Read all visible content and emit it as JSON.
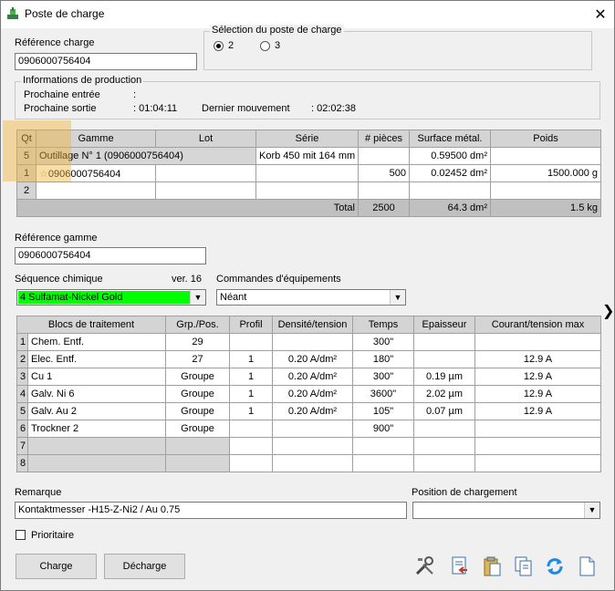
{
  "window": {
    "title": "Poste de charge"
  },
  "ref_charge": {
    "label": "Référence charge",
    "value": "0906000756404"
  },
  "selection": {
    "label": "Sélection du poste de charge",
    "opt1": "2",
    "opt2": "3"
  },
  "production": {
    "label": "Informations de production",
    "next_entry_label": "Prochaine entrée",
    "next_entry_value": ":",
    "next_exit_label": "Prochaine sortie",
    "next_exit_value": ": 01:04:11",
    "last_move_label": "Dernier mouvement",
    "last_move_value": ": 02:02:38"
  },
  "charge_table": {
    "headers": [
      "Qt",
      "Gamme",
      "Lot",
      "Série",
      "# pièces",
      "Surface métal.",
      "Poids"
    ],
    "rows": [
      [
        "5",
        "Outillage N° 1  (0906000756404)",
        "",
        "Korb 450 mit 164 mm",
        "",
        "0.59500 dm²",
        ""
      ],
      [
        "1",
        "0906000756404",
        "",
        "",
        "500",
        "0.02452 dm²",
        "1500.000 g"
      ],
      [
        "2",
        "",
        "",
        "",
        "",
        "",
        ""
      ]
    ],
    "total_label": "Total",
    "total_pieces": "2500",
    "total_surface": "64.3 dm²",
    "total_weight": "1.5 kg"
  },
  "ref_gamme": {
    "label": "Référence gamme",
    "value": "0906000756404"
  },
  "sequence": {
    "label": "Séquence chimique",
    "version": "ver. 16",
    "value": "4 Sulfamat-Nickel Gold",
    "color": "#00ff00"
  },
  "commands": {
    "label": "Commandes d'équipements",
    "value": "Néant"
  },
  "blocs_table": {
    "headers": [
      "Blocs de traitement",
      "Grp./Pos.",
      "Profil",
      "Densité/tension",
      "Temps",
      "Epaisseur",
      "Courant/tension max"
    ],
    "rows": [
      [
        "1",
        "Chem. Entf.",
        "29",
        "",
        "",
        "300\"",
        "",
        ""
      ],
      [
        "2",
        "Elec. Entf.",
        "27",
        "1",
        "0.20 A/dm²",
        "180\"",
        "",
        "12.9 A"
      ],
      [
        "3",
        "Cu 1",
        "Groupe",
        "1",
        "0.20 A/dm²",
        "300\"",
        "0.19 µm",
        "12.9 A"
      ],
      [
        "4",
        "Galv. Ni 6",
        "Groupe",
        "1",
        "0.20 A/dm²",
        "3600\"",
        "2.02 µm",
        "12.9 A"
      ],
      [
        "5",
        "Galv. Au 2",
        "Groupe",
        "1",
        "0.20 A/dm²",
        "105\"",
        "0.07 µm",
        "12.9 A"
      ],
      [
        "6",
        "Trockner 2",
        "Groupe",
        "",
        "",
        "900\"",
        "",
        ""
      ],
      [
        "7",
        "",
        "",
        "",
        "",
        "",
        "",
        ""
      ],
      [
        "8",
        "",
        "",
        "",
        "",
        "",
        "",
        ""
      ]
    ]
  },
  "remarque": {
    "label": "Remarque",
    "value": "Kontaktmesser -H15-Z-Ni2 / Au 0.75"
  },
  "position": {
    "label": "Position de chargement",
    "value": ""
  },
  "prioritaire": {
    "label": "Prioritaire"
  },
  "buttons": {
    "charge": "Charge",
    "decharge": "Décharge"
  },
  "icons": [
    "tools-icon",
    "document-remove-icon",
    "clipboard-icon",
    "copy-icon",
    "refresh-icon",
    "blank-document-icon"
  ]
}
